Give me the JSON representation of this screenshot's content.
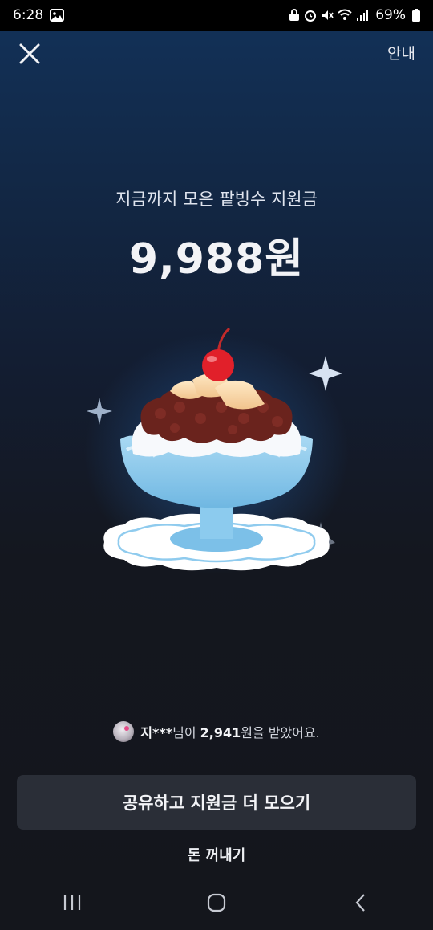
{
  "status_bar": {
    "time": "6:28",
    "battery": "69%",
    "icons": [
      "image-icon",
      "lock-notify-icon",
      "alarm-icon",
      "mute-icon",
      "wifi-icon",
      "signal-icon",
      "battery-icon"
    ]
  },
  "header": {
    "info_label": "안내"
  },
  "main": {
    "subtitle": "지금까지 모은 팥빙수 지원금",
    "amount": "9,988원"
  },
  "receiver": {
    "name": "지***",
    "suffix1": "님이 ",
    "amount": "2,941",
    "suffix2": "원을 받았어요."
  },
  "actions": {
    "share_label": "공유하고 지원금 더 모으기",
    "withdraw_label": "돈 꺼내기"
  },
  "colors": {
    "background_top": "#12325a",
    "background_bottom": "#14161c",
    "button_bg": "#2a2e37"
  }
}
